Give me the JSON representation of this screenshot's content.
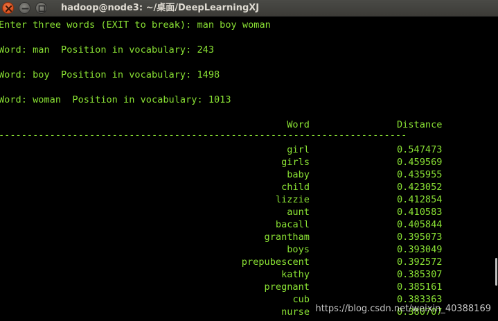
{
  "window": {
    "title": "hadoop@node3: ~/桌面/DeepLearningXJ"
  },
  "terminal": {
    "prompt_line": "Enter three words (EXIT to break): man boy woman",
    "word_lines": [
      "Word: man  Position in vocabulary: 243",
      "Word: boy  Position in vocabulary: 1498",
      "Word: woman  Position in vocabulary: 1013"
    ],
    "header": {
      "word": "Word",
      "distance": "Distance"
    },
    "divider": "------------------------------------------------------------------------",
    "results": [
      {
        "word": "girl",
        "distance": "0.547473"
      },
      {
        "word": "girls",
        "distance": "0.459569"
      },
      {
        "word": "baby",
        "distance": "0.435955"
      },
      {
        "word": "child",
        "distance": "0.423052"
      },
      {
        "word": "lizzie",
        "distance": "0.412854"
      },
      {
        "word": "aunt",
        "distance": "0.410583"
      },
      {
        "word": "bacall",
        "distance": "0.405844"
      },
      {
        "word": "grantham",
        "distance": "0.395073"
      },
      {
        "word": "boys",
        "distance": "0.393049"
      },
      {
        "word": "prepubescent",
        "distance": "0.392572"
      },
      {
        "word": "kathy",
        "distance": "0.385307"
      },
      {
        "word": "pregnant",
        "distance": "0.385161"
      },
      {
        "word": "cub",
        "distance": "0.383363"
      },
      {
        "word": "nurse",
        "distance": "0.380707"
      }
    ]
  },
  "watermark": "https://blog.csdn.net/weixin_40388169",
  "colors": {
    "terminal_text": "#8ae234",
    "terminal_bg": "#000000",
    "titlebar": "#3c3b37",
    "close_button": "#e05a22"
  }
}
